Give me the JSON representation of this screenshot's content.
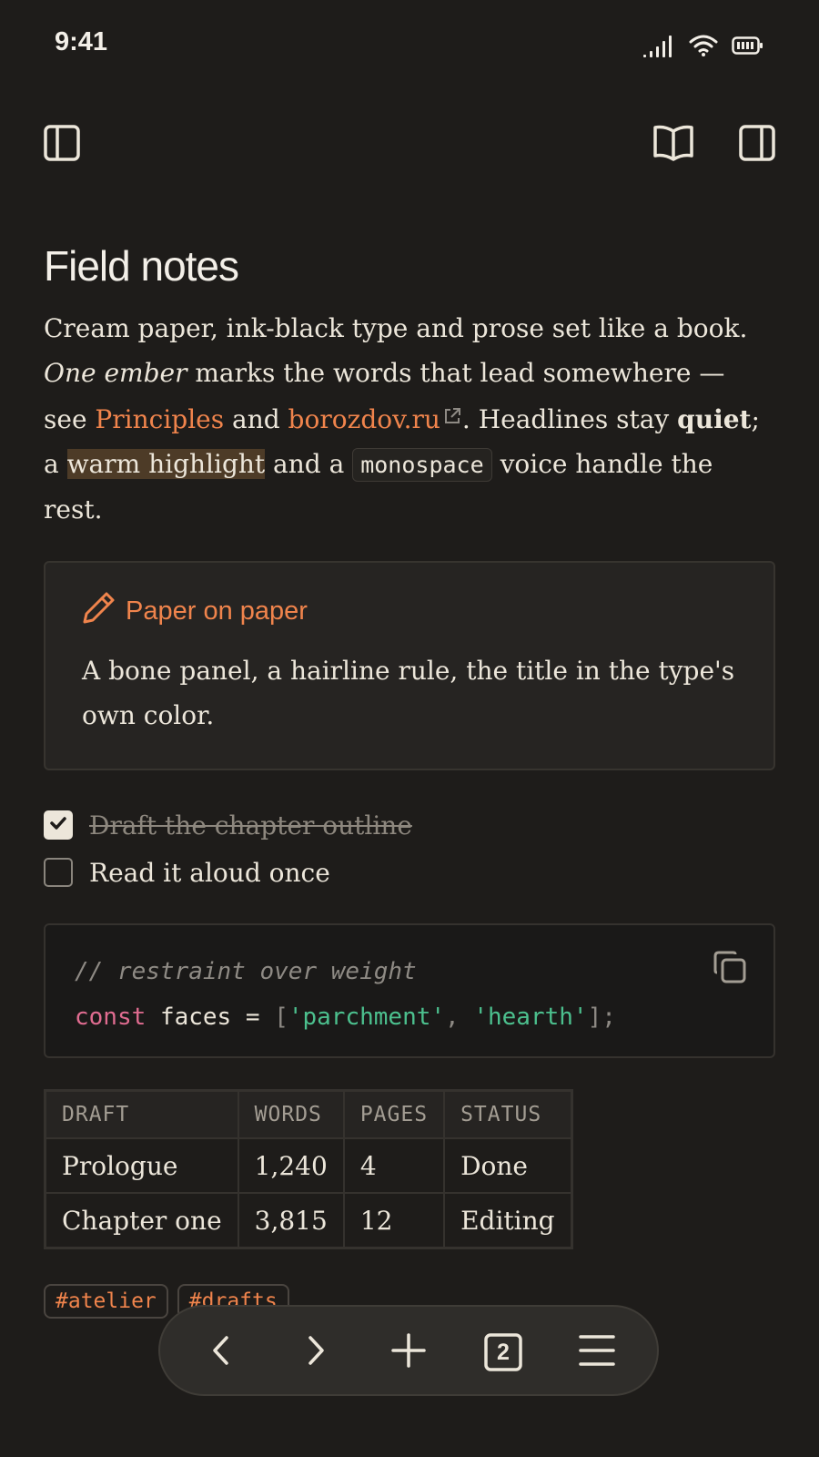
{
  "status_bar": {
    "time": "9:41",
    "icons": [
      "cellular-signal-icon",
      "wifi-icon",
      "battery-icon"
    ]
  },
  "toolbar": {
    "left": [
      "sidebar-left-icon"
    ],
    "right": [
      "book-open-icon",
      "sidebar-right-icon"
    ]
  },
  "document": {
    "title": "Field notes",
    "paragraph": {
      "t1": "Cream paper, ink-black type and prose set like a book. ",
      "ember": "One ember",
      "t2": " marks the words that lead somewhere — see ",
      "link1": "Principles",
      "t3": " and ",
      "link2": "borozdov.ru",
      "t4": ". Headlines stay ",
      "quiet": "quiet",
      "t5": "; a ",
      "highlight": "warm highlight",
      "t6": " and a ",
      "code": "monospace",
      "t7": " voice handle the rest."
    },
    "callout": {
      "icon": "pencil-icon",
      "title": "Paper on paper",
      "body": "A bone panel, a hairline rule, the title in the type's own color."
    },
    "tasks": [
      {
        "label": "Draft the chapter outline",
        "checked": true
      },
      {
        "label": "Read it aloud once",
        "checked": false
      }
    ],
    "code_block": {
      "comment": "// restraint over weight",
      "keyword": "const",
      "name": "faces",
      "eq": "=",
      "open": "[",
      "str1": "'parchment'",
      "comma": ",",
      "str2": "'hearth'",
      "close": "];"
    },
    "table": {
      "headers": [
        "DRAFT",
        "WORDS",
        "PAGES",
        "STATUS"
      ],
      "rows": [
        [
          "Prologue",
          "1,240",
          "4",
          "Done"
        ],
        [
          "Chapter one",
          "3,815",
          "12",
          "Editing"
        ]
      ]
    },
    "tags": [
      "#atelier",
      "#drafts"
    ]
  },
  "bottom_nav": {
    "tab_count": "2",
    "icons": [
      "back-icon",
      "forward-icon",
      "new-tab-icon",
      "tabs-icon",
      "menu-icon"
    ]
  },
  "colors": {
    "background": "#1e1c1a",
    "text": "#ece6da",
    "accent": "#f0844c",
    "highlight": "#4d3b27",
    "string": "#4cc08e",
    "keyword": "#e06c90"
  }
}
